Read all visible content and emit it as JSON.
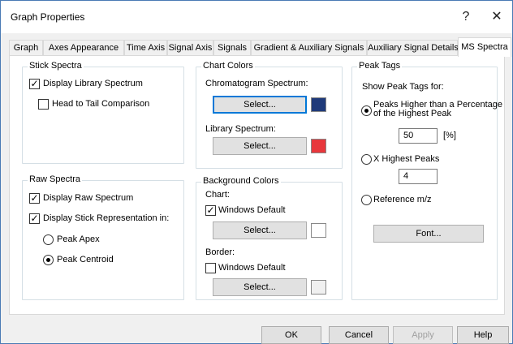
{
  "window": {
    "title": "Graph Properties",
    "help_glyph": "?",
    "close_glyph": "✕"
  },
  "tabs": [
    {
      "label": "Graph"
    },
    {
      "label": "Axes Appearance"
    },
    {
      "label": "Time Axis"
    },
    {
      "label": "Signal Axis"
    },
    {
      "label": "Signals"
    },
    {
      "label": "Gradient & Auxiliary Signals"
    },
    {
      "label": "Auxiliary Signal Details"
    },
    {
      "label": "MS Spectra"
    }
  ],
  "active_tab": "MS Spectra",
  "stick_spectra": {
    "title": "Stick Spectra",
    "display_library": {
      "label": "Display Library Spectrum",
      "checked": true
    },
    "head_to_tail": {
      "label": "Head to Tail Comparison",
      "checked": false
    }
  },
  "raw_spectra": {
    "title": "Raw Spectra",
    "display_raw": {
      "label": "Display Raw Spectrum",
      "checked": true
    },
    "display_stick": {
      "label": "Display Stick Representation in:",
      "checked": true
    },
    "peak_apex": {
      "label": "Peak Apex",
      "selected": false
    },
    "peak_centroid": {
      "label": "Peak Centroid",
      "selected": true
    }
  },
  "chart_colors": {
    "title": "Chart Colors",
    "chromatogram_label": "Chromatogram Spectrum:",
    "chromatogram_button": "Select...",
    "chromatogram_color": "#1f3a7a",
    "library_label": "Library Spectrum:",
    "library_button": "Select...",
    "library_color": "#e8373c"
  },
  "background_colors": {
    "title": "Background Colors",
    "chart_label": "Chart:",
    "chart_default": {
      "label": "Windows Default",
      "checked": true
    },
    "chart_button": "Select...",
    "chart_color": "#ffffff",
    "border_label": "Border:",
    "border_default": {
      "label": "Windows Default",
      "checked": false
    },
    "border_button": "Select...",
    "border_color": "#f0f0f0"
  },
  "peak_tags": {
    "title": "Peak Tags",
    "show_label": "Show Peak Tags for:",
    "percentage_option": {
      "label_line1": "Peaks Higher than a Percentage",
      "label_line2": "of the Highest Peak",
      "selected": true
    },
    "percentage_value": "50",
    "percentage_unit": "[%]",
    "x_highest": {
      "label": "X Highest Peaks",
      "selected": false
    },
    "x_highest_value": "4",
    "reference": {
      "label": "Reference m/z",
      "selected": false
    },
    "font_button": "Font..."
  },
  "footer": {
    "ok": "OK",
    "cancel": "Cancel",
    "apply": "Apply",
    "help": "Help"
  }
}
